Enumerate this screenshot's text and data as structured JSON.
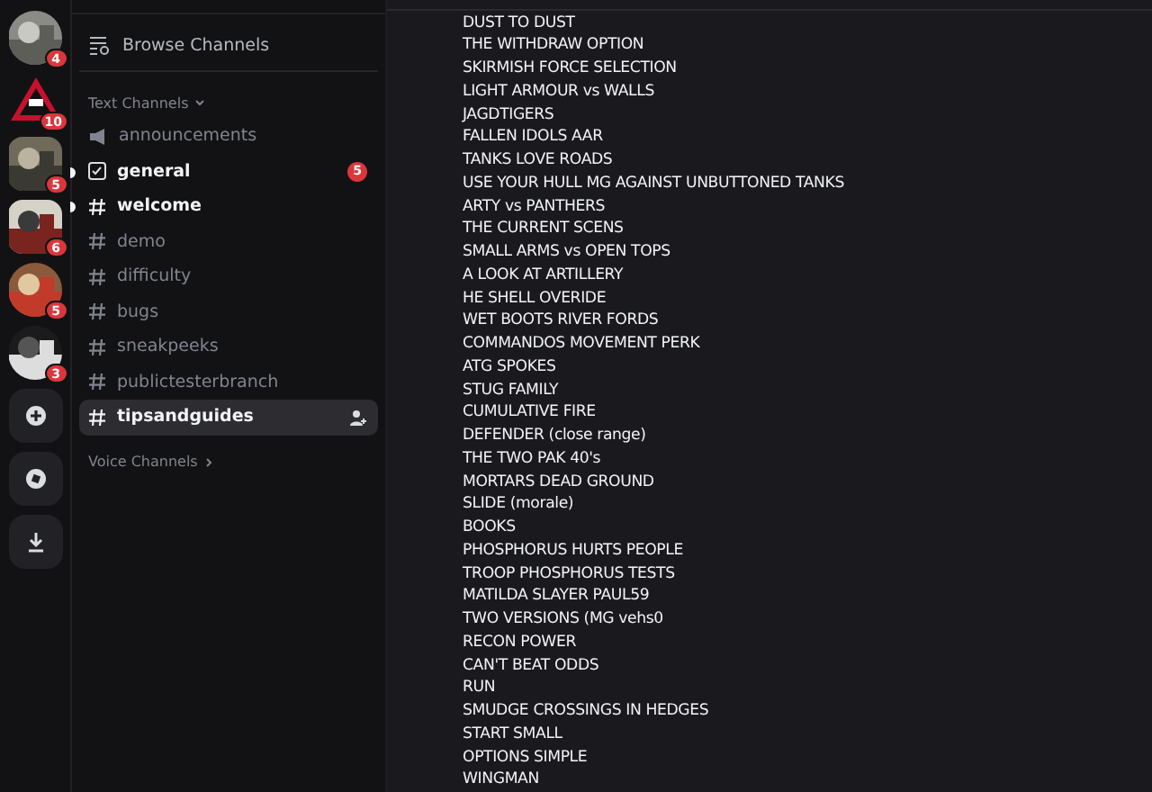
{
  "servers": [
    {
      "badge": "4",
      "kind": "circle"
    },
    {
      "badge": "10",
      "kind": "triangle"
    },
    {
      "badge": "5",
      "kind": "rounded"
    },
    {
      "badge": "6",
      "kind": "rounded"
    },
    {
      "badge": "5",
      "kind": "circle"
    },
    {
      "badge": "3",
      "kind": "circle"
    }
  ],
  "rail_actions": [
    {
      "kind": "add"
    },
    {
      "kind": "discover"
    },
    {
      "kind": "download"
    }
  ],
  "browse": {
    "label": "Browse Channels"
  },
  "categories": [
    {
      "label": "Text Channels",
      "expanded": true,
      "channels": [
        {
          "name": "announcements",
          "kind": "announcement",
          "unread": false,
          "selected": false
        },
        {
          "name": "general",
          "kind": "rules",
          "unread": true,
          "selected": false,
          "badge": "5"
        },
        {
          "name": "welcome",
          "kind": "text",
          "unread": true,
          "selected": false
        },
        {
          "name": "demo",
          "kind": "text",
          "unread": false,
          "selected": false
        },
        {
          "name": "difficulty",
          "kind": "text",
          "unread": false,
          "selected": false
        },
        {
          "name": "bugs",
          "kind": "text",
          "unread": false,
          "selected": false
        },
        {
          "name": "sneakpeeks",
          "kind": "text",
          "unread": false,
          "selected": false
        },
        {
          "name": "publictesterbranch",
          "kind": "text",
          "unread": false,
          "selected": false
        },
        {
          "name": "tipsandguides",
          "kind": "text",
          "unread": false,
          "selected": true
        }
      ]
    },
    {
      "label": "Voice Channels",
      "expanded": false
    }
  ],
  "messages": [
    "DUST TO DUST",
    "THE WITHDRAW OPTION",
    "SKIRMISH FORCE SELECTION",
    "LIGHT ARMOUR vs WALLS",
    "JAGDTIGERS",
    "FALLEN IDOLS AAR",
    "TANKS LOVE ROADS",
    "USE YOUR HULL MG AGAINST UNBUTTONED TANKS",
    "ARTY vs PANTHERS",
    "THE CURRENT SCENS",
    "SMALL ARMS vs OPEN TOPS",
    "A LOOK AT ARTILLERY",
    "HE SHELL OVERIDE",
    "WET BOOTS RIVER FORDS",
    "COMMANDOS MOVEMENT PERK",
    "ATG SPOKES",
    "STUG FAMILY",
    "CUMULATIVE FIRE",
    "DEFENDER (close range)",
    "THE TWO PAK 40's",
    "MORTARS DEAD GROUND",
    "SLIDE (morale)",
    "BOOKS",
    "PHOSPHORUS HURTS PEOPLE",
    "TROOP PHOSPHORUS TESTS",
    "MATILDA SLAYER PAUL59",
    "TWO VERSIONS (MG vehs0",
    "RECON POWER",
    "CAN'T BEAT ODDS",
    "RUN",
    "SMUDGE CROSSINGS IN HEDGES",
    "START SMALL",
    "OPTIONS  SIMPLE",
    "WINGMAN"
  ]
}
